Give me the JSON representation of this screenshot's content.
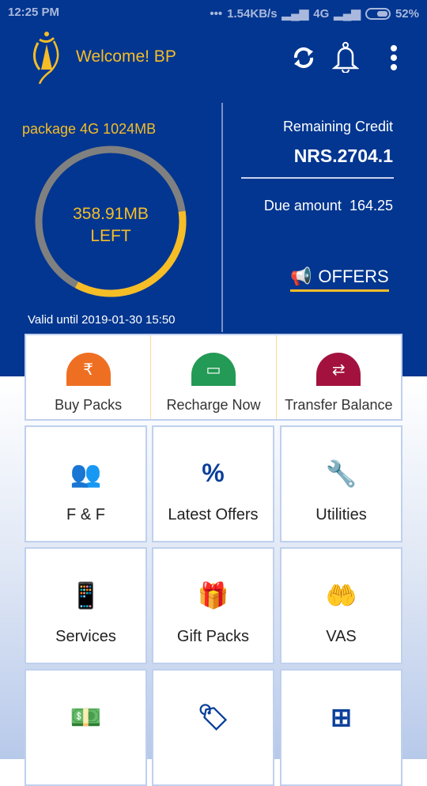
{
  "status": {
    "time": "12:25 PM",
    "dots": "•••",
    "speed": "1.54KB/s",
    "network": "4G",
    "battery": "52%"
  },
  "header": {
    "title": "Welcome! BP",
    "icons": [
      "logo",
      "refresh-icon",
      "bell-icon",
      "more-vert-icon"
    ]
  },
  "usage": {
    "package": "package 4G 1024MB",
    "left_amount": "358.91MB",
    "left_label": "LEFT",
    "remaining_mb": 358.91,
    "total_mb": 1024,
    "valid": "Valid  until 2019-01-30 15:50"
  },
  "credit": {
    "label": "Remaining Credit",
    "value": "NRS.2704.1",
    "due_label": "Due amount",
    "due_value": "164.25",
    "offers": "OFFERS"
  },
  "quick": [
    {
      "label": "Buy Packs",
      "color": "#ef6f22"
    },
    {
      "label": "Recharge Now",
      "color": "#239a55"
    },
    {
      "label": "Transfer Balance",
      "color": "#a3123f"
    }
  ],
  "tiles": [
    {
      "label": "F & F",
      "icon": "group-icon"
    },
    {
      "label": "Latest Offers",
      "icon": "discount-badge-icon"
    },
    {
      "label": "Utilities",
      "icon": "tools-icon"
    },
    {
      "label": "Services",
      "icon": "phone-gear-icon"
    },
    {
      "label": "Gift Packs",
      "icon": "gift-icon"
    },
    {
      "label": "VAS",
      "icon": "hand-coins-icon"
    },
    {
      "label": "",
      "icon": "money-hand-icon"
    },
    {
      "label": "",
      "icon": "price-tag-icon"
    },
    {
      "label": "",
      "icon": "apps-add-icon"
    }
  ],
  "colors": {
    "primary": "#023690",
    "accent": "#f6bd27"
  }
}
